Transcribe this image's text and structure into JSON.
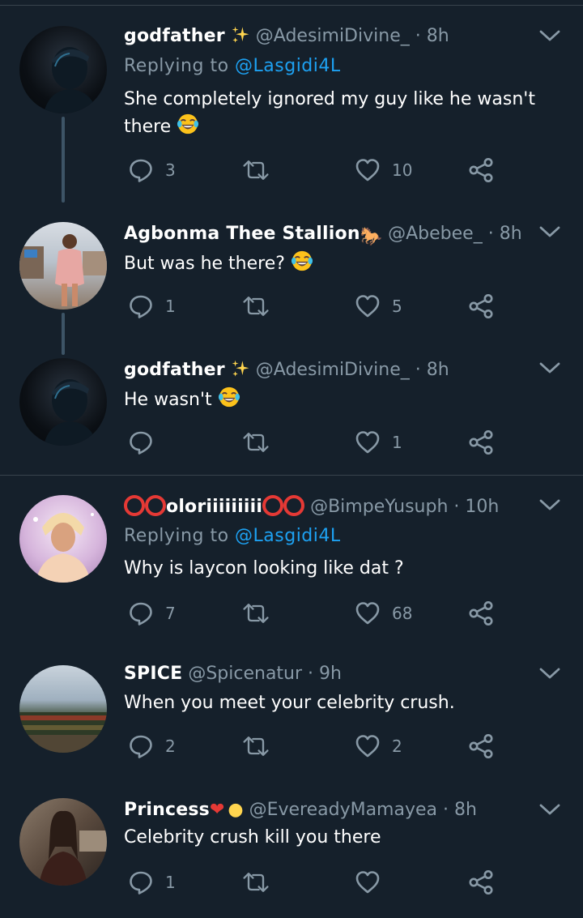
{
  "tweets": [
    {
      "name": "godfather",
      "name_emoji": "sparkles",
      "handle": "@AdesimiDivine_",
      "time": "· 8h",
      "replying_prefix": "Replying to",
      "replying_to": "@Lasgidi4L",
      "text_line1": "She completely ignored my guy like he wasn't",
      "text_line2": "there",
      "text_emoji": "face-with-tears-of-joy",
      "replies": "3",
      "retweets": "",
      "likes": "10"
    },
    {
      "name": "Agbonma Thee Stallion",
      "name_emoji": "horse",
      "handle": "@Abebee_",
      "time": "· 8h",
      "text_line1": "But was he there?",
      "text_emoji": "face-with-tears-of-joy",
      "replies": "1",
      "retweets": "",
      "likes": "5"
    },
    {
      "name": "godfather",
      "name_emoji": "sparkles",
      "handle": "@AdesimiDivine_",
      "time": "· 8h",
      "text_line1": "He wasn't",
      "text_emoji": "face-with-tears-of-joy",
      "replies": "",
      "retweets": "",
      "likes": "1"
    },
    {
      "name": "oloriiiiiiiii",
      "name_emoji": "red-circles",
      "handle": "@BimpeYusuph",
      "time": "· 10h",
      "replying_prefix": "Replying to",
      "replying_to": "@Lasgidi4L",
      "text_line1": "Why is laycon looking like dat ?",
      "replies": "7",
      "retweets": "",
      "likes": "68"
    },
    {
      "name": "SPICE",
      "handle": "@Spicenatur",
      "time": "· 9h",
      "text_line1": "When you meet your celebrity crush.",
      "replies": "2",
      "retweets": "",
      "likes": "2"
    },
    {
      "name": "Princess",
      "name_emoji": "heart-bulb",
      "handle": "@EvereadyMamayea",
      "time": "· 8h",
      "text_line1": "Celebrity crush kill you there",
      "replies": "1",
      "retweets": "",
      "likes": ""
    }
  ],
  "colors": {
    "background": "#15202b",
    "secondary_text": "#8899a6",
    "link": "#1da1f2",
    "divider": "#38444d"
  }
}
